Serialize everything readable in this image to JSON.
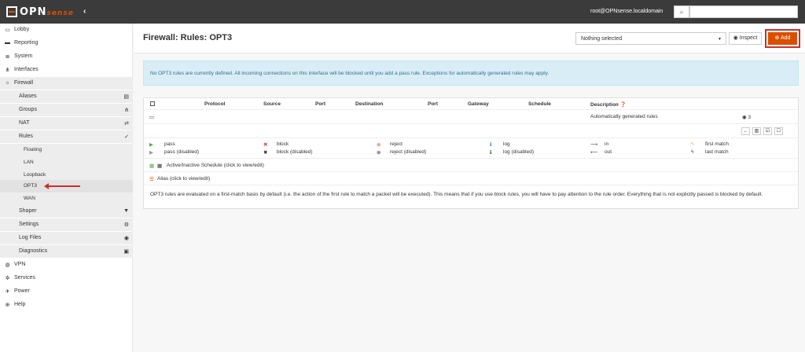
{
  "header": {
    "logo_text": "OPN",
    "logo_suffix": "sense",
    "collapse_glyph": "‹",
    "user": "root@OPNsense.localdomain",
    "search_icon": "⌕"
  },
  "sidebar": {
    "items": [
      {
        "label": "Lobby",
        "icon": "▭"
      },
      {
        "label": "Reporting",
        "icon": "▬"
      },
      {
        "label": "System",
        "icon": "≣"
      },
      {
        "label": "Interfaces",
        "icon": "⋔"
      },
      {
        "label": "Firewall",
        "icon": "☼"
      },
      {
        "label": "Aliases",
        "icon": "▤"
      },
      {
        "label": "Groups",
        "icon": "⋔"
      },
      {
        "label": "NAT",
        "icon": "⇄"
      },
      {
        "label": "Rules",
        "icon": "✓"
      },
      {
        "label": "Floating",
        "icon": ""
      },
      {
        "label": "LAN",
        "icon": ""
      },
      {
        "label": "Loopback",
        "icon": ""
      },
      {
        "label": "OPT3",
        "icon": ""
      },
      {
        "label": "WAN",
        "icon": ""
      },
      {
        "label": "Shaper",
        "icon": "▼"
      },
      {
        "label": "Settings",
        "icon": "⚙"
      },
      {
        "label": "Log Files",
        "icon": "◉"
      },
      {
        "label": "Diagnostics",
        "icon": "▣"
      },
      {
        "label": "VPN",
        "icon": "◍"
      },
      {
        "label": "Services",
        "icon": "✲"
      },
      {
        "label": "Power",
        "icon": "✈"
      },
      {
        "label": "Help",
        "icon": "⊕"
      }
    ]
  },
  "main": {
    "title": "Firewall: Rules: OPT3",
    "select_value": "Nothing selected",
    "inspect_label": "◉ Inspect",
    "add_label": "⊕ Add",
    "alert": "No OPT3 rules are currently defined. All incoming connections on this interface will be blocked until you add a pass rule. Exceptions for automatically generated rules may apply."
  },
  "table": {
    "headers": [
      "Protocol",
      "Source",
      "Port",
      "Destination",
      "Port",
      "Gateway",
      "Schedule",
      "Description ❓"
    ],
    "auto_rules_label": "Automatically generated rules",
    "auto_rules_badge": "◉ 3",
    "legend": [
      {
        "icon": "▶",
        "label": "pass"
      },
      {
        "icon": "✖",
        "label": "block"
      },
      {
        "icon": "⊗",
        "label": "reject"
      },
      {
        "icon": "ℹ",
        "label": "log"
      },
      {
        "icon": "⟶",
        "label": "in"
      },
      {
        "icon": "ϟ",
        "label": "first match"
      },
      {
        "icon": "▶",
        "label": "pass (disabled)"
      },
      {
        "icon": "✖",
        "label": "block (disabled)"
      },
      {
        "icon": "⊗",
        "label": "reject (disabled)"
      },
      {
        "icon": "ℹ",
        "label": "log (disabled)"
      },
      {
        "icon": "⟵",
        "label": "out"
      },
      {
        "icon": "ϟ",
        "label": "last match"
      }
    ],
    "schedule_label": "Active/Inactive Schedule (click to view/edit)",
    "alias_label": "Alias (click to view/edit)",
    "footer": "OPT3 rules are evaluated on a first-match basis by default (i.e. the action of the first rule to match a packet will be executed). This means that if you use block rules, you will have to pay attention to the rule order. Everything that is not explicitly passed is blocked by default."
  }
}
